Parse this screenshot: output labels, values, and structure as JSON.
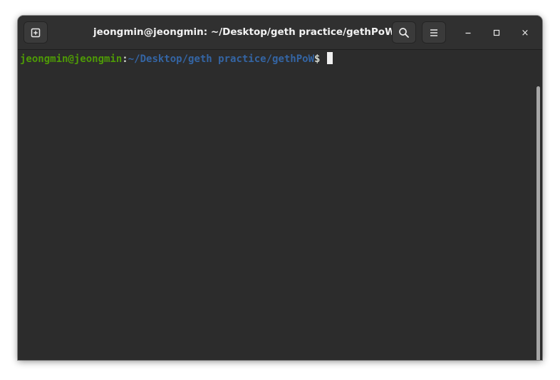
{
  "window": {
    "title": "jeongmin@jeongmin: ~/Desktop/geth practice/gethPoW"
  },
  "titlebar": {
    "new_tab_icon": "new-tab-icon",
    "search_icon": "search-icon",
    "menu_icon": "hamburger-menu-icon",
    "minimize_icon": "minimize-icon",
    "maximize_icon": "maximize-icon",
    "close_icon": "close-icon",
    "close_glyph": "×"
  },
  "terminal": {
    "user_host": "jeongmin@jeongmin",
    "colon": ":",
    "path": "~/Desktop/geth practice/gethPoW",
    "prompt_symbol": "$ "
  },
  "colors": {
    "background": "#2c2c2c",
    "titlebar": "#303030",
    "user_host": "#4e9a06",
    "path": "#3465a4",
    "text": "#d3d7cf"
  }
}
